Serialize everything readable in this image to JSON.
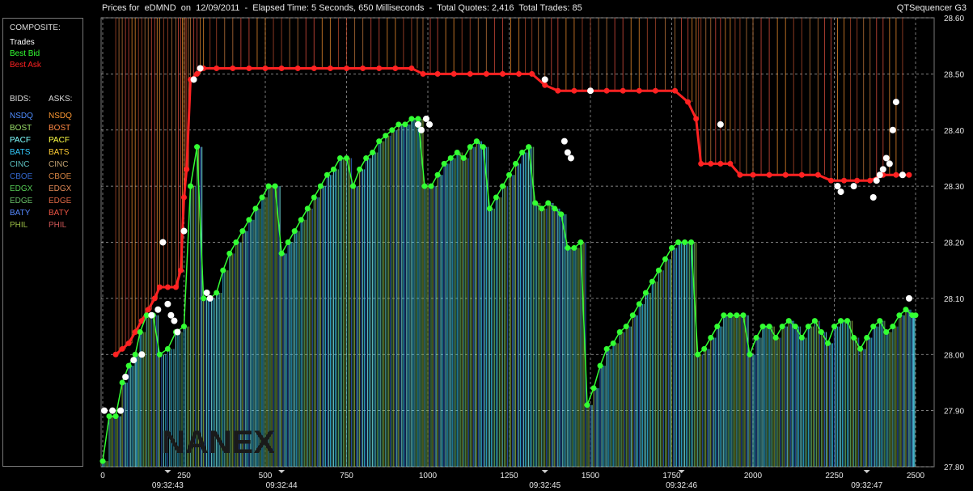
{
  "header": {
    "title": "Prices for  eDMND  on  12/09/2011  -  Elapsed Time: 5 Seconds, 650 Milliseconds  -  Total Quotes: 2,416  Total Trades: 85",
    "app_name": "QTSequencer G3"
  },
  "legend": {
    "composite_label": "COMPOSITE:",
    "composite_items": [
      {
        "label": "Trades",
        "color": "#ffffff"
      },
      {
        "label": "Best Bid",
        "color": "#33ff33"
      },
      {
        "label": "Best Ask",
        "color": "#ff2222"
      }
    ],
    "bids_label": "BIDS:",
    "asks_label": "ASKS:",
    "exchanges": [
      {
        "bid": "NSDQ",
        "ask": "NSDQ",
        "bid_color": "#4f8dff",
        "ask_color": "#ff9933"
      },
      {
        "bid": "BOST",
        "ask": "BOST",
        "bid_color": "#9adf6a",
        "ask_color": "#ff8844"
      },
      {
        "bid": "PACF",
        "ask": "PACF",
        "bid_color": "#7fffff",
        "ask_color": "#ffff44"
      },
      {
        "bid": "BATS",
        "ask": "BATS",
        "bid_color": "#33ccff",
        "ask_color": "#ffcc33"
      },
      {
        "bid": "CINC",
        "ask": "CINC",
        "bid_color": "#5cc0c0",
        "ask_color": "#c0a070"
      },
      {
        "bid": "CBOE",
        "ask": "CBOE",
        "bid_color": "#3366cc",
        "ask_color": "#d08040"
      },
      {
        "bid": "EDGX",
        "ask": "EDGX",
        "bid_color": "#55cc55",
        "ask_color": "#e08855"
      },
      {
        "bid": "EDGE",
        "ask": "EDGE",
        "bid_color": "#66bb66",
        "ask_color": "#dd6644"
      },
      {
        "bid": "BATY",
        "ask": "BATY",
        "bid_color": "#5588ff",
        "ask_color": "#ee5544"
      },
      {
        "bid": "PHIL",
        "ask": "PHIL",
        "bid_color": "#99bb44",
        "ask_color": "#cc5555"
      }
    ]
  },
  "chart_data": {
    "type": "scatter",
    "title": "",
    "xlabel": "",
    "ylabel": "",
    "xlim": [
      0,
      2500
    ],
    "ylim": [
      27.8,
      28.6
    ],
    "x_ticks": [
      0,
      250,
      500,
      750,
      1000,
      1250,
      1500,
      1750,
      2000,
      2250,
      2500
    ],
    "y_ticks": [
      "27.80",
      "27.90",
      "28.00",
      "28.10",
      "28.20",
      "28.30",
      "28.40",
      "28.50",
      "28.60"
    ],
    "time_labels": [
      {
        "x": 200,
        "label": "09:32:43"
      },
      {
        "x": 550,
        "label": "09:32:44"
      },
      {
        "x": 1360,
        "label": "09:32:45"
      },
      {
        "x": 1780,
        "label": "09:32:46"
      },
      {
        "x": 2350,
        "label": "09:32:47"
      }
    ],
    "grid": true,
    "watermark": "NANEX",
    "series": [
      {
        "name": "Best Ask",
        "color": "#ff2222",
        "points": [
          [
            40,
            28.0
          ],
          [
            60,
            28.01
          ],
          [
            80,
            28.02
          ],
          [
            100,
            28.04
          ],
          [
            120,
            28.06
          ],
          [
            140,
            28.08
          ],
          [
            160,
            28.1
          ],
          [
            175,
            28.12
          ],
          [
            200,
            28.12
          ],
          [
            225,
            28.12
          ],
          [
            240,
            28.15
          ],
          [
            250,
            28.28
          ],
          [
            258,
            28.33
          ],
          [
            270,
            28.49
          ],
          [
            290,
            28.5
          ],
          [
            310,
            28.51
          ],
          [
            350,
            28.51
          ],
          [
            400,
            28.51
          ],
          [
            450,
            28.51
          ],
          [
            500,
            28.51
          ],
          [
            550,
            28.51
          ],
          [
            600,
            28.51
          ],
          [
            650,
            28.51
          ],
          [
            700,
            28.51
          ],
          [
            750,
            28.51
          ],
          [
            800,
            28.51
          ],
          [
            850,
            28.51
          ],
          [
            900,
            28.51
          ],
          [
            950,
            28.51
          ],
          [
            985,
            28.5
          ],
          [
            1030,
            28.5
          ],
          [
            1080,
            28.5
          ],
          [
            1130,
            28.5
          ],
          [
            1180,
            28.5
          ],
          [
            1230,
            28.5
          ],
          [
            1280,
            28.5
          ],
          [
            1320,
            28.5
          ],
          [
            1360,
            28.48
          ],
          [
            1400,
            28.47
          ],
          [
            1450,
            28.47
          ],
          [
            1500,
            28.47
          ],
          [
            1550,
            28.47
          ],
          [
            1600,
            28.47
          ],
          [
            1650,
            28.47
          ],
          [
            1700,
            28.47
          ],
          [
            1760,
            28.47
          ],
          [
            1800,
            28.45
          ],
          [
            1825,
            28.42
          ],
          [
            1840,
            28.34
          ],
          [
            1870,
            28.34
          ],
          [
            1900,
            28.34
          ],
          [
            1930,
            28.34
          ],
          [
            1960,
            28.32
          ],
          [
            2000,
            28.32
          ],
          [
            2050,
            28.32
          ],
          [
            2100,
            28.32
          ],
          [
            2150,
            28.32
          ],
          [
            2200,
            28.32
          ],
          [
            2240,
            28.31
          ],
          [
            2280,
            28.31
          ],
          [
            2320,
            28.31
          ],
          [
            2360,
            28.31
          ],
          [
            2400,
            28.32
          ],
          [
            2440,
            28.32
          ],
          [
            2480,
            28.32
          ]
        ]
      },
      {
        "name": "Best Bid",
        "color": "#33ff33",
        "points": [
          [
            0,
            27.81
          ],
          [
            20,
            27.89
          ],
          [
            40,
            27.89
          ],
          [
            60,
            27.95
          ],
          [
            80,
            27.98
          ],
          [
            100,
            28.0
          ],
          [
            115,
            28.04
          ],
          [
            135,
            28.07
          ],
          [
            155,
            28.07
          ],
          [
            175,
            28.0
          ],
          [
            200,
            28.01
          ],
          [
            225,
            28.04
          ],
          [
            250,
            28.05
          ],
          [
            270,
            28.3
          ],
          [
            290,
            28.37
          ],
          [
            310,
            28.1
          ],
          [
            330,
            28.1
          ],
          [
            350,
            28.11
          ],
          [
            370,
            28.15
          ],
          [
            390,
            28.18
          ],
          [
            410,
            28.2
          ],
          [
            430,
            28.22
          ],
          [
            450,
            28.24
          ],
          [
            470,
            28.26
          ],
          [
            490,
            28.28
          ],
          [
            510,
            28.3
          ],
          [
            530,
            28.3
          ],
          [
            550,
            28.18
          ],
          [
            570,
            28.2
          ],
          [
            590,
            28.22
          ],
          [
            610,
            28.24
          ],
          [
            630,
            28.26
          ],
          [
            650,
            28.28
          ],
          [
            670,
            28.3
          ],
          [
            690,
            28.32
          ],
          [
            710,
            28.33
          ],
          [
            730,
            28.35
          ],
          [
            750,
            28.35
          ],
          [
            770,
            28.3
          ],
          [
            790,
            28.33
          ],
          [
            810,
            28.35
          ],
          [
            830,
            28.36
          ],
          [
            850,
            28.38
          ],
          [
            870,
            28.39
          ],
          [
            890,
            28.4
          ],
          [
            910,
            28.41
          ],
          [
            930,
            28.41
          ],
          [
            950,
            28.42
          ],
          [
            970,
            28.42
          ],
          [
            990,
            28.3
          ],
          [
            1010,
            28.3
          ],
          [
            1030,
            28.32
          ],
          [
            1050,
            28.34
          ],
          [
            1070,
            28.35
          ],
          [
            1090,
            28.36
          ],
          [
            1110,
            28.35
          ],
          [
            1130,
            28.37
          ],
          [
            1150,
            28.38
          ],
          [
            1170,
            28.37
          ],
          [
            1190,
            28.26
          ],
          [
            1210,
            28.28
          ],
          [
            1230,
            28.3
          ],
          [
            1250,
            28.32
          ],
          [
            1270,
            28.34
          ],
          [
            1290,
            28.36
          ],
          [
            1310,
            28.37
          ],
          [
            1330,
            28.27
          ],
          [
            1350,
            28.26
          ],
          [
            1370,
            28.27
          ],
          [
            1390,
            28.26
          ],
          [
            1410,
            28.25
          ],
          [
            1430,
            28.19
          ],
          [
            1450,
            28.19
          ],
          [
            1470,
            28.2
          ],
          [
            1490,
            27.91
          ],
          [
            1510,
            27.94
          ],
          [
            1530,
            27.98
          ],
          [
            1550,
            28.01
          ],
          [
            1570,
            28.02
          ],
          [
            1590,
            28.04
          ],
          [
            1610,
            28.05
          ],
          [
            1630,
            28.07
          ],
          [
            1650,
            28.09
          ],
          [
            1670,
            28.11
          ],
          [
            1690,
            28.13
          ],
          [
            1710,
            28.15
          ],
          [
            1730,
            28.17
          ],
          [
            1750,
            28.19
          ],
          [
            1770,
            28.2
          ],
          [
            1790,
            28.2
          ],
          [
            1810,
            28.2
          ],
          [
            1830,
            28.0
          ],
          [
            1850,
            28.01
          ],
          [
            1870,
            28.03
          ],
          [
            1890,
            28.05
          ],
          [
            1910,
            28.07
          ],
          [
            1930,
            28.07
          ],
          [
            1950,
            28.07
          ],
          [
            1970,
            28.07
          ],
          [
            1990,
            28.0
          ],
          [
            2010,
            28.03
          ],
          [
            2030,
            28.05
          ],
          [
            2050,
            28.05
          ],
          [
            2070,
            28.03
          ],
          [
            2090,
            28.05
          ],
          [
            2110,
            28.06
          ],
          [
            2130,
            28.05
          ],
          [
            2150,
            28.03
          ],
          [
            2170,
            28.05
          ],
          [
            2190,
            28.06
          ],
          [
            2210,
            28.04
          ],
          [
            2230,
            28.02
          ],
          [
            2250,
            28.05
          ],
          [
            2270,
            28.06
          ],
          [
            2290,
            28.06
          ],
          [
            2310,
            28.03
          ],
          [
            2330,
            28.01
          ],
          [
            2350,
            28.03
          ],
          [
            2370,
            28.05
          ],
          [
            2390,
            28.06
          ],
          [
            2410,
            28.04
          ],
          [
            2430,
            28.05
          ],
          [
            2450,
            28.07
          ],
          [
            2470,
            28.08
          ],
          [
            2490,
            28.07
          ],
          [
            2500,
            28.07
          ]
        ]
      },
      {
        "name": "Trades",
        "color": "#ffffff",
        "points": [
          [
            5,
            27.9
          ],
          [
            30,
            27.9
          ],
          [
            55,
            27.9
          ],
          [
            70,
            27.96
          ],
          [
            95,
            27.99
          ],
          [
            120,
            28.0
          ],
          [
            150,
            28.07
          ],
          [
            170,
            28.08
          ],
          [
            185,
            28.2
          ],
          [
            200,
            28.09
          ],
          [
            210,
            28.07
          ],
          [
            220,
            28.06
          ],
          [
            230,
            28.04
          ],
          [
            250,
            28.22
          ],
          [
            280,
            28.49
          ],
          [
            300,
            28.51
          ],
          [
            320,
            28.11
          ],
          [
            330,
            28.1
          ],
          [
            970,
            28.41
          ],
          [
            980,
            28.4
          ],
          [
            995,
            28.42
          ],
          [
            1005,
            28.41
          ],
          [
            1360,
            28.49
          ],
          [
            1420,
            28.38
          ],
          [
            1430,
            28.36
          ],
          [
            1440,
            28.35
          ],
          [
            1500,
            28.47
          ],
          [
            1900,
            28.41
          ],
          [
            2260,
            28.3
          ],
          [
            2270,
            28.29
          ],
          [
            2310,
            28.3
          ],
          [
            2370,
            28.28
          ],
          [
            2380,
            28.31
          ],
          [
            2390,
            28.32
          ],
          [
            2400,
            28.33
          ],
          [
            2410,
            28.35
          ],
          [
            2420,
            28.34
          ],
          [
            2430,
            28.4
          ],
          [
            2440,
            28.45
          ],
          [
            2460,
            28.32
          ],
          [
            2480,
            28.1
          ]
        ]
      }
    ]
  }
}
